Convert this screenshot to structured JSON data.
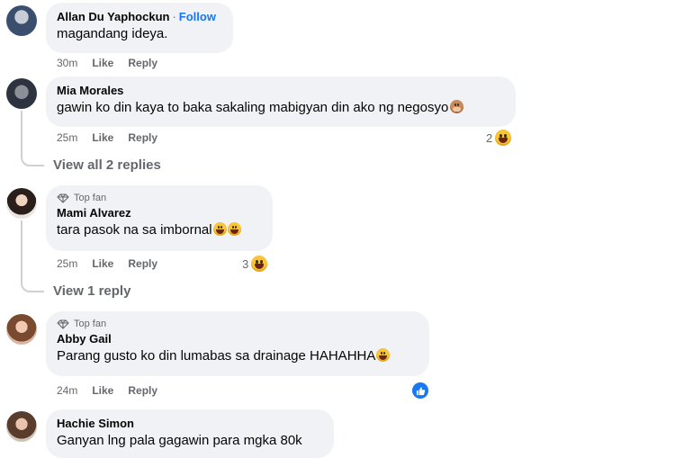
{
  "comments": [
    {
      "author": "Allan Du Yaphockun",
      "follow_label": "Follow",
      "text": "magandang ideya.",
      "time": "30m",
      "like_label": "Like",
      "reply_label": "Reply"
    },
    {
      "author": "Mia Morales",
      "text": "gawin ko din kaya to baka sakaling mabigyan din ako ng negosyo",
      "time": "25m",
      "like_label": "Like",
      "reply_label": "Reply",
      "reaction_count": "2",
      "reaction_icon": "laugh-emoji-icon",
      "view_replies_label": "View all 2 replies"
    },
    {
      "badge": "Top fan",
      "author": "Mami Alvarez",
      "text": "tara pasok na sa imbornal",
      "time": "25m",
      "like_label": "Like",
      "reply_label": "Reply",
      "reaction_count": "3",
      "reaction_icon": "laugh-emoji-icon",
      "view_replies_label": "View 1 reply"
    },
    {
      "badge": "Top fan",
      "author": "Abby Gail",
      "text": "Parang gusto ko din lumabas sa drainage HAHAHHA",
      "time": "24m",
      "like_label": "Like",
      "reply_label": "Reply",
      "reaction_icon": "like-icon"
    },
    {
      "author": "Hachie Simon",
      "text": "Ganyan lng pala gagawin para mgka 80k"
    }
  ],
  "colors": {
    "bubble": "#f0f2f5",
    "link_blue": "#1877f2",
    "secondary_text": "#65676b"
  }
}
